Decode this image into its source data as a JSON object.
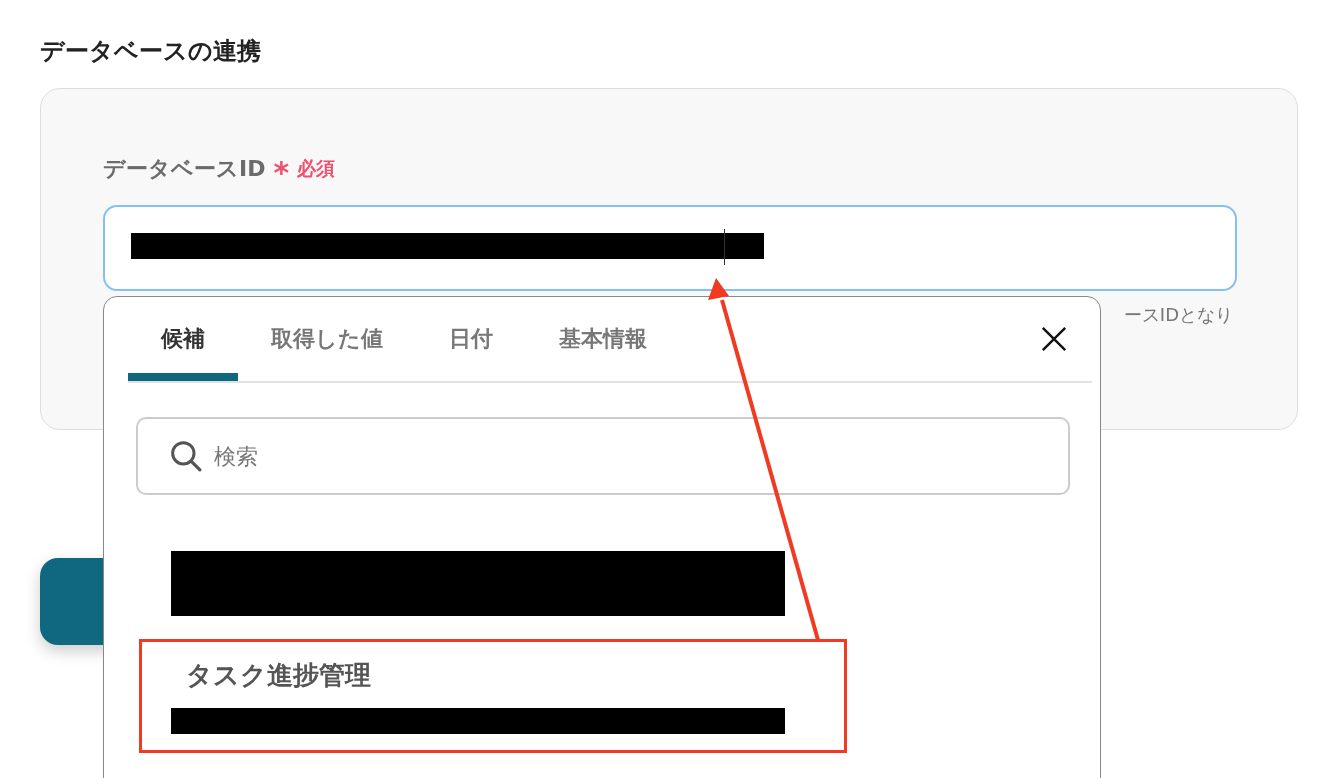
{
  "section_title": "データベースの連携",
  "field": {
    "label": "データベースID",
    "required_mark": "*",
    "required_text": "必須",
    "hint": "ースIDとなり"
  },
  "dropdown": {
    "tabs": [
      {
        "label": "候補",
        "selected": true
      },
      {
        "label": "取得した値",
        "selected": false
      },
      {
        "label": "日付",
        "selected": false
      },
      {
        "label": "基本情報",
        "selected": false
      }
    ],
    "search": {
      "placeholder": "検索"
    },
    "items": [
      {
        "highlighted": false
      },
      {
        "title": "タスク進捗管理",
        "highlighted": true
      }
    ]
  }
}
